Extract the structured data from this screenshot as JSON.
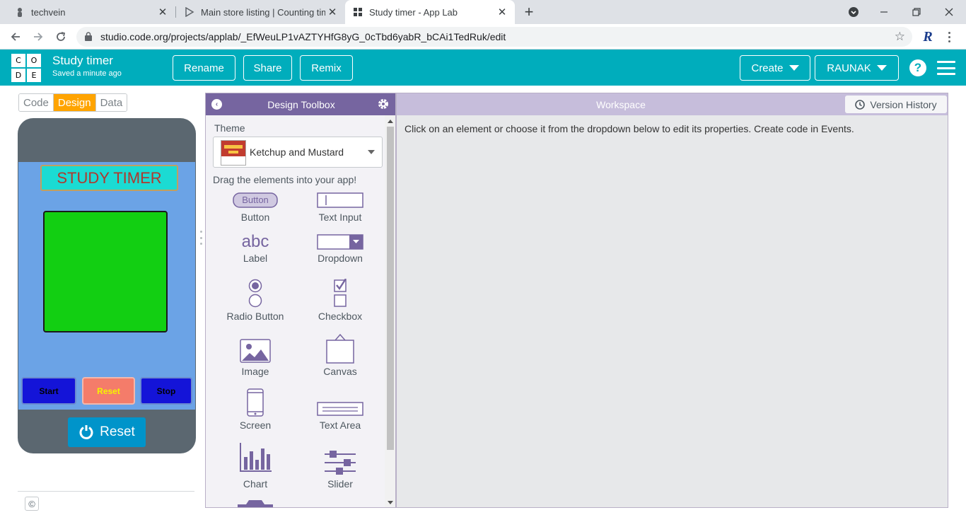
{
  "browser": {
    "tabs": [
      {
        "title": "techvein",
        "icon": "person-icon"
      },
      {
        "title": "Main store listing | Counting time",
        "icon": "play-store-icon"
      },
      {
        "title": "Study timer - App Lab",
        "icon": "applab-icon"
      }
    ],
    "url": "studio.code.org/projects/applab/_EfWeuLP1vAZTYHfG8yG_0cTbd6yabR_bCAi1TedRuk/edit",
    "profile_initial": "R"
  },
  "header": {
    "logo_letters": [
      "C",
      "O",
      "D",
      "E"
    ],
    "project_name": "Study timer",
    "saved_status": "Saved a minute ago",
    "rename": "Rename",
    "share": "Share",
    "remix": "Remix",
    "create": "Create",
    "user": "RAUNAK",
    "help": "?"
  },
  "mode_toggle": {
    "code": "Code",
    "design": "Design",
    "data": "Data",
    "selected": "Design"
  },
  "app_preview": {
    "title": "STUDY TIMER",
    "buttons": {
      "start": "Start",
      "reset": "Reset",
      "stop": "Stop"
    },
    "run_reset": "Reset",
    "copyright": "©"
  },
  "toolbox": {
    "title": "Design Toolbox",
    "theme_label": "Theme",
    "theme_value": "Ketchup and Mustard",
    "drag_hint": "Drag the elements into your app!",
    "button_preview_text": "Button",
    "label_preview_text": "abc",
    "items": {
      "button": "Button",
      "text_input": "Text Input",
      "label": "Label",
      "dropdown": "Dropdown",
      "radio_button": "Radio Button",
      "checkbox": "Checkbox",
      "image": "Image",
      "canvas": "Canvas",
      "screen": "Screen",
      "text_area": "Text Area",
      "chart": "Chart",
      "slider": "Slider"
    }
  },
  "workspace": {
    "title": "Workspace",
    "version_history": "Version History",
    "hint": "Click on an element or choose it from the dropdown below to edit its properties. Create code in Events."
  },
  "colors": {
    "header_teal": "#00adbc",
    "toolbox_purple": "#7665a0",
    "design_orange": "#ffa400",
    "screen_blue": "#6ba3e6",
    "timer_green": "#12cf12"
  }
}
